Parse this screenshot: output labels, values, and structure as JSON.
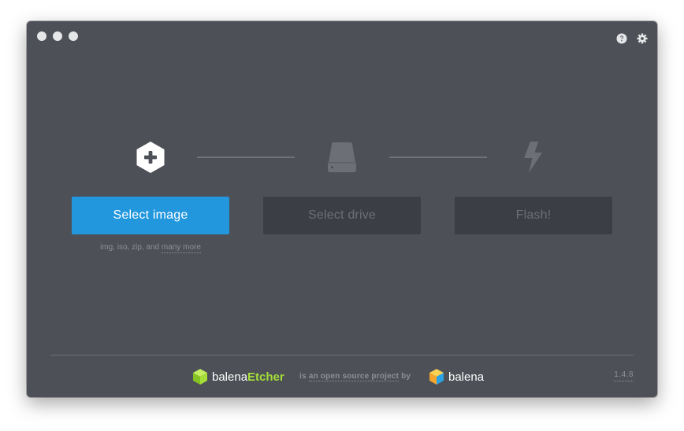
{
  "window": {
    "controls": [
      "close",
      "minimize",
      "maximize"
    ]
  },
  "header": {
    "icons": [
      "help-icon",
      "settings-icon"
    ]
  },
  "steps": {
    "image": {
      "icon": "plus-hexagon-icon",
      "button_label": "Select image",
      "hint_prefix": "img, iso, zip, and",
      "hint_link": "many more"
    },
    "drive": {
      "icon": "drive-icon",
      "button_label": "Select drive"
    },
    "flash": {
      "icon": "lightning-icon",
      "button_label": "Flash!"
    }
  },
  "footer": {
    "brand_prefix": "balena",
    "brand_accent": "Etcher",
    "tagline_prefix": "is",
    "tagline_link": "an open source project",
    "tagline_suffix": "by",
    "company": "balena",
    "version": "1.4.8"
  },
  "colors": {
    "window_bg": "#4d5057",
    "primary": "#2297de",
    "disabled_bg": "#3b3e44",
    "disabled_text": "#6c6f75",
    "accent_green": "#a5de37"
  }
}
